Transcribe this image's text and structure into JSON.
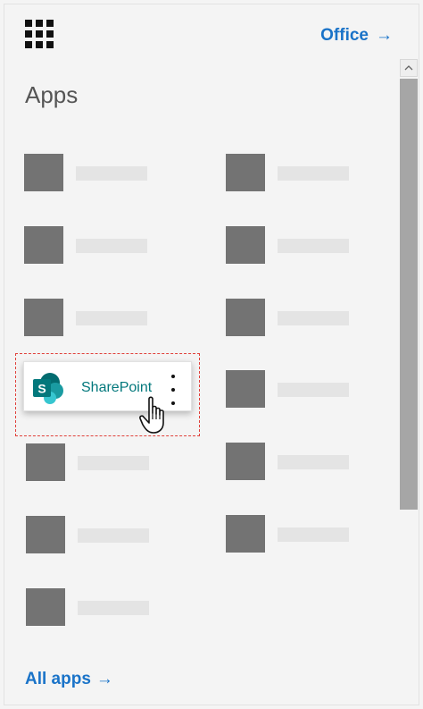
{
  "header": {
    "office_label": "Office",
    "office_arrow": "→"
  },
  "apps_section": {
    "heading": "Apps",
    "highlighted_app": {
      "label": "SharePoint",
      "logo_letter": "S"
    }
  },
  "footer": {
    "all_apps_label": "All apps",
    "all_apps_arrow": "→"
  },
  "icons": [
    "app-launcher-icon",
    "arrow-right-icon",
    "sharepoint-icon",
    "more-options-icon",
    "hand-cursor-icon",
    "scroll-up-icon"
  ],
  "colors": {
    "link": "#1a73c8",
    "sharepoint_teal": "#03787c",
    "placeholder_tile": "#737373",
    "placeholder_bar": "#e4e4e4",
    "highlight_border": "#e0403a"
  }
}
